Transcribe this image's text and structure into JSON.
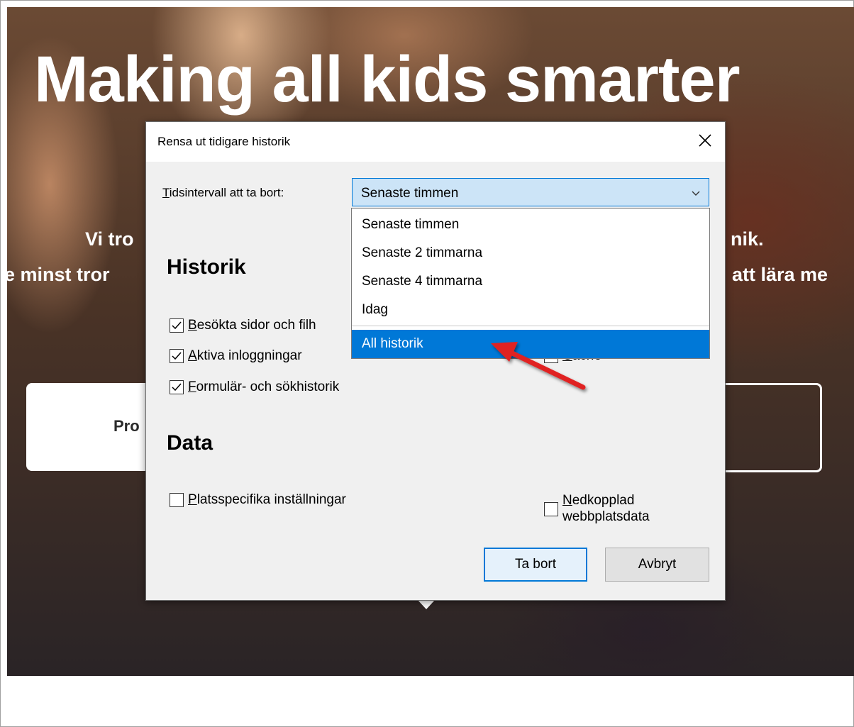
{
  "hero": {
    "title": "Making all kids smarter",
    "tagline_left_1": "Vi tro",
    "tagline_right_1": "nik.",
    "tagline_left_2": "e minst tror",
    "tagline_right_2": "att lära me",
    "button_left_label": "Pro"
  },
  "dialog": {
    "title": "Rensa ut tidigare historik",
    "range_label_prefix": "T",
    "range_label_rest": "idsintervall att ta bort:",
    "range_selected": "Senaste timmen",
    "range_options": [
      "Senaste timmen",
      "Senaste 2 timmarna",
      "Senaste 4 timmarna",
      "Idag",
      "All historik"
    ],
    "highlighted_option": "All historik",
    "history_heading": "Historik",
    "history_items": [
      {
        "accel": "B",
        "rest": "esökta sidor och filh",
        "checked": true
      },
      {
        "accel": "A",
        "rest": "ktiva inloggningar",
        "checked": true
      },
      {
        "accel": "F",
        "rest": "ormulär- och sökhistorik",
        "checked": true
      }
    ],
    "cache_item": {
      "accel": "C",
      "rest": "ache",
      "checked": false
    },
    "data_heading": "Data",
    "site_settings": {
      "accel": "P",
      "rest": "latsspecifika inställningar",
      "checked": false
    },
    "offline_data": {
      "accel": "N",
      "rest_line1": "edkopplad",
      "line2": "webbplatsdata",
      "checked": false
    },
    "ok_label": "Ta bort",
    "cancel_label": "Avbryt"
  },
  "icons": {
    "close": "close-icon",
    "dropdown": "chevron-down-icon",
    "checkmark": "checkmark-icon",
    "annotation_arrow": "red-arrow-icon",
    "scroll_down": "triangle-down-icon"
  },
  "colors": {
    "accent": "#0078d7",
    "dialog_bg": "#f0f0f0",
    "selection_bg": "#0078d7",
    "annotation_arrow": "#e02424"
  }
}
